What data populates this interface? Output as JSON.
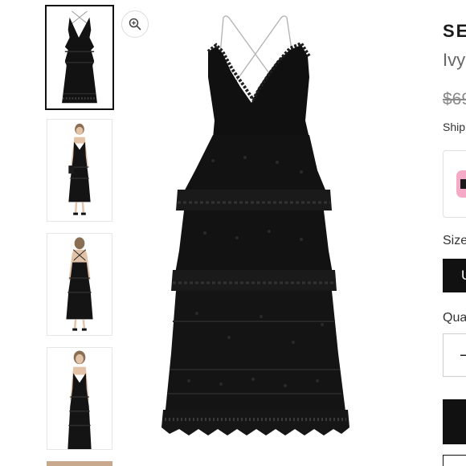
{
  "brand": "SE",
  "product_name": "Ivy",
  "price": "$69",
  "shipping_text": "Ship",
  "size_label": "Size",
  "size_option": "U",
  "quantity_label": "Qua",
  "quantity_control": "–",
  "thumbnails": [
    {
      "name": "dress-flat"
    },
    {
      "name": "model-front"
    },
    {
      "name": "model-back"
    },
    {
      "name": "model-closeup"
    }
  ],
  "colors": {
    "accent": "#111111",
    "promo": "#f4a9c6",
    "muted": "#888888"
  },
  "icons": {
    "zoom": "zoom-in-icon"
  }
}
